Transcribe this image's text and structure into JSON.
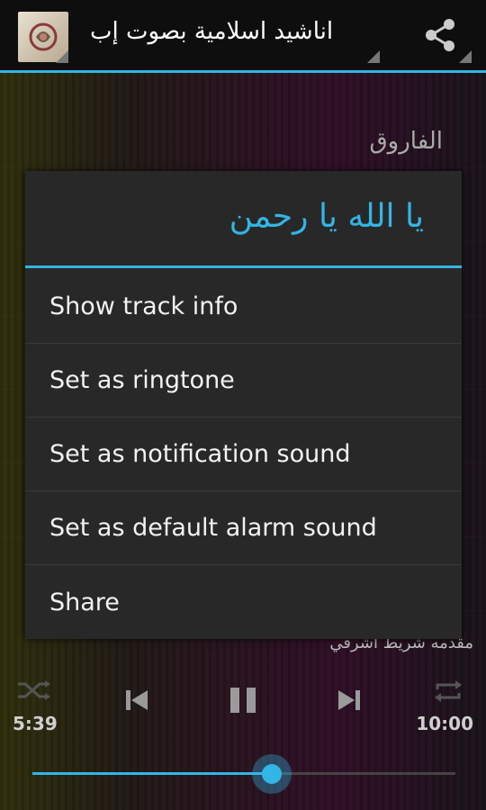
{
  "action_bar": {
    "title": "اناشيد اسلامية بصوت إب",
    "app_icon": "app-logo-icon",
    "share_icon": "share-icon"
  },
  "player": {
    "artist": "الفاروق",
    "album": "مقدمه شريط أشرقي",
    "elapsed": "5:39",
    "duration": "10:00",
    "progress": 0.565,
    "icons": {
      "shuffle": "shuffle-icon",
      "previous": "previous-icon",
      "pause": "pause-icon",
      "next": "next-icon",
      "repeat": "repeat-icon"
    }
  },
  "dialog": {
    "title": "يا الله يا رحمن",
    "items": [
      {
        "label": "Show track info"
      },
      {
        "label": "Set as ringtone"
      },
      {
        "label": "Set as notification sound"
      },
      {
        "label": "Set as default alarm sound"
      },
      {
        "label": "Share"
      }
    ]
  },
  "colors": {
    "accent": "#33b5e5",
    "dialog_bg": "#282828",
    "actionbar_bg": "#0e0e0e"
  }
}
